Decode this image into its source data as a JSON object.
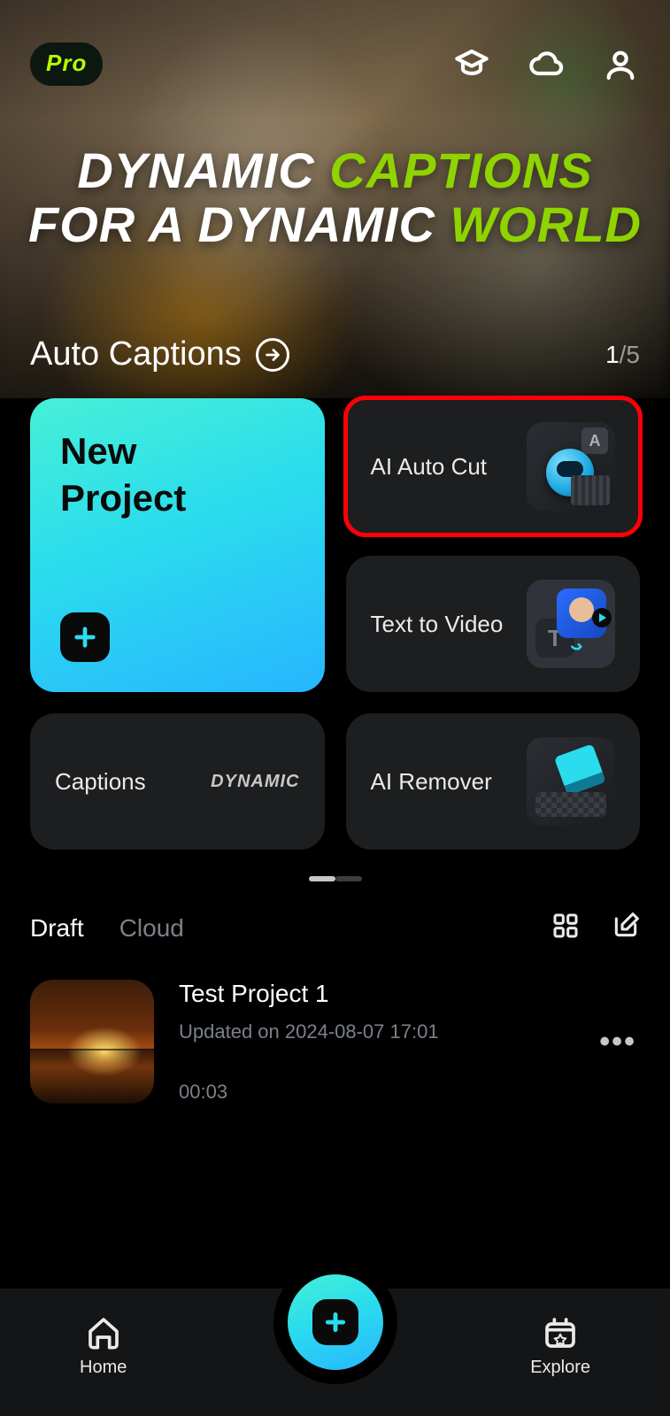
{
  "header": {
    "pro_badge": "Pro",
    "headline_part1": "DYNAMIC",
    "headline_part2": "CAPTIONS",
    "headline_part3": "FOR  A DYNAMIC",
    "headline_part4": "WORLD",
    "feature_name": "Auto Captions",
    "pager_current": "1",
    "pager_separator": "/",
    "pager_total": "5"
  },
  "actions": {
    "new_project": "New\nProject",
    "ai_auto_cut": "AI Auto Cut",
    "text_to_video": "Text to Video",
    "captions": "Captions",
    "captions_thumb_text": "DYNAMIC",
    "ai_remover": "AI Remover"
  },
  "drafts": {
    "tab_draft": "Draft",
    "tab_cloud": "Cloud",
    "items": [
      {
        "title": "Test Project 1",
        "updated": "Updated on 2024-08-07 17:01",
        "duration": "00:03"
      }
    ]
  },
  "nav": {
    "home": "Home",
    "explore": "Explore"
  }
}
